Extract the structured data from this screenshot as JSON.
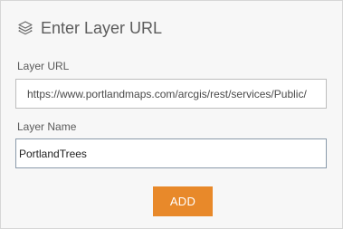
{
  "header": {
    "icon": "layers-icon",
    "title": "Enter Layer URL"
  },
  "form": {
    "layer_url": {
      "label": "Layer URL",
      "value": "https://www.portlandmaps.com/arcgis/rest/services/Public/"
    },
    "layer_name": {
      "label": "Layer Name",
      "value": "PortlandTrees"
    }
  },
  "actions": {
    "add_label": "ADD",
    "add_color": "#e8892a"
  }
}
